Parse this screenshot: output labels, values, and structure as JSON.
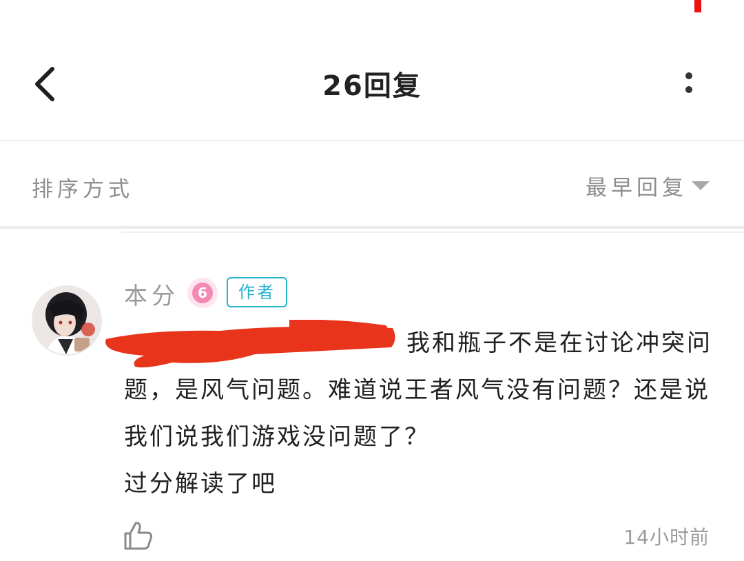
{
  "header": {
    "title": "26回复"
  },
  "sort": {
    "label": "排序方式",
    "selected": "最早回复"
  },
  "comment": {
    "username": "本分",
    "level": "6",
    "author_tag": "作者",
    "text": "我和瓶子不是在讨论冲突问题，是风气问题。难道说王者风气没有问题？还是说我们说我们游戏没问题了？",
    "text_line2": "过分解读了吧",
    "time": "14小时前"
  },
  "icons": {
    "back": "chevron-left-icon",
    "more": "more-vertical-icon",
    "sort_caret": "caret-down-icon",
    "like": "thumbs-up-icon"
  },
  "colors": {
    "author_tag": "#25b3cc",
    "level_badge": "#f38ab6",
    "redaction": "#e8341a",
    "status_mark": "#ee1111"
  }
}
